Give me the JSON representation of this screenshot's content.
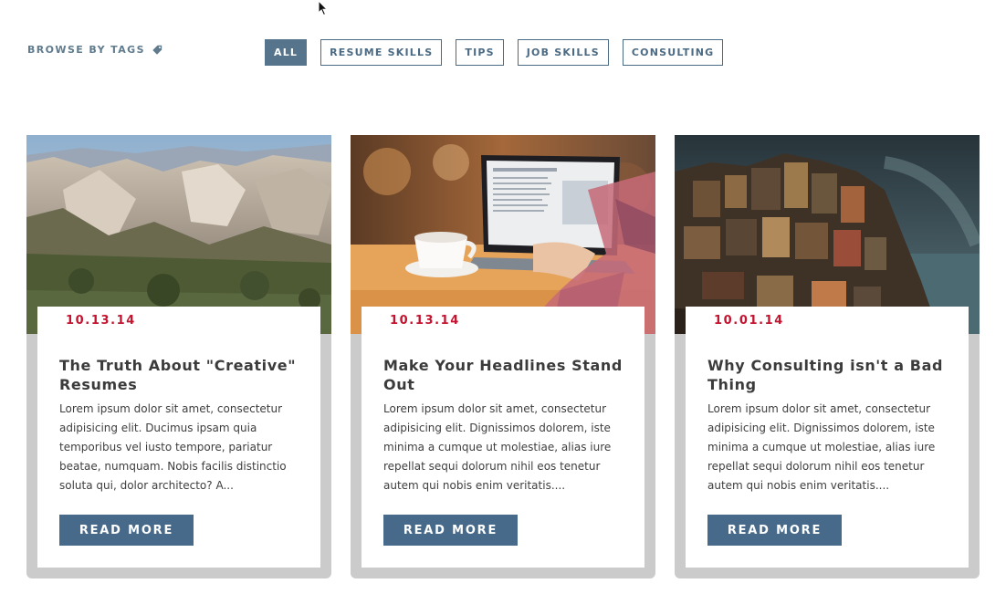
{
  "filter": {
    "label": "BROWSE BY TAGS",
    "icon": "tag-icon",
    "tags": [
      "ALL",
      "RESUME SKILLS",
      "TIPS",
      "JOB SKILLS",
      "CONSULTING"
    ],
    "active_tag": "ALL"
  },
  "posts": [
    {
      "image_alt": "mountain canyon landscape",
      "date": "10.13.14",
      "title": "The Truth About \"Creative\" Resumes",
      "excerpt": "Lorem ipsum dolor sit amet, consectetur adipisicing elit. Ducimus ipsam quia temporibus vel iusto tempore, pariatur beatae, numquam. Nobis facilis distinctio soluta qui, dolor architecto? A...",
      "button": "READ MORE"
    },
    {
      "image_alt": "laptop and coffee cup",
      "date": "10.13.14",
      "title": "Make Your Headlines Stand Out",
      "excerpt": "Lorem ipsum dolor sit amet, consectetur adipisicing elit. Dignissimos dolorem, iste minima a cumque ut molestiae, alias iure repellat sequi dolorum nihil eos tenetur autem qui nobis enim veritatis....",
      "button": "READ MORE"
    },
    {
      "image_alt": "cliffside village by the sea",
      "date": "10.01.14",
      "title": "Why Consulting isn't a Bad Thing",
      "excerpt": "Lorem ipsum dolor sit amet, consectetur adipisicing elit. Dignissimos dolorem, iste minima a cumque ut molestiae, alias iure repellat sequi dolorum nihil eos tenetur autem qui nobis enim veritatis....",
      "button": "READ MORE"
    }
  ],
  "colors": {
    "accent": "#47698a",
    "date": "#c4132f",
    "tag_border": "#4b6a83",
    "card_frame": "#cbcbcb"
  }
}
